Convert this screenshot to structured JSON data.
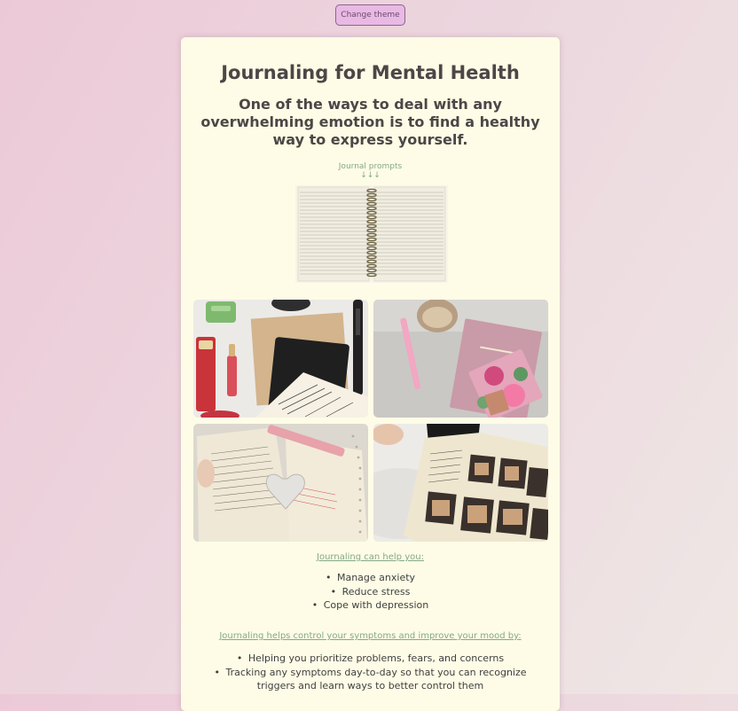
{
  "theme_button": {
    "label": "Change theme"
  },
  "article": {
    "title": "Journaling for Mental Health",
    "subtitle": "One of the ways to deal with any overwhelming emotion is to find a healthy way to express yourself.",
    "prompts_link": "Journal prompts",
    "prompts_arrows": "↓↓↓"
  },
  "section_help": {
    "heading": "Journaling can help you:",
    "items": [
      "Manage anxiety",
      "Reduce stress",
      "Cope with depression"
    ]
  },
  "section_control": {
    "heading": "Journaling helps control your symptoms and improve your mood by:",
    "items": [
      "Helping you prioritize problems, fears, and concerns",
      "Tracking any symptoms day-to-day so that you can recognize triggers and learn ways to better control them"
    ]
  },
  "colors": {
    "background": "#ecc9d7",
    "card": "#fefce6",
    "accent_green": "#84a985",
    "button": "#e8b9e3"
  }
}
